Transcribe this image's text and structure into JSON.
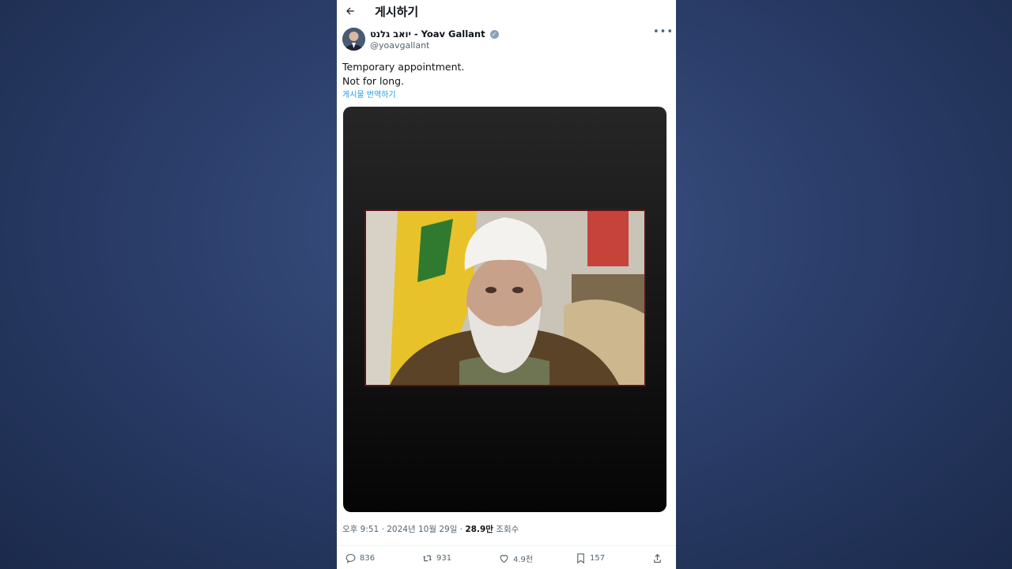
{
  "header": {
    "back_icon": "arrow-left-icon",
    "title": "게시하기"
  },
  "post": {
    "display_name": "יואב גלנט - Yoav Gallant",
    "verified_icon": "verified-badge-icon",
    "handle": "@yoavgallant",
    "more_icon": "more-horizontal-icon",
    "text_line1": "Temporary appointment.",
    "text_line2": "Not for long.",
    "translate_label": "게시물 번역하기",
    "meta_time": "오후 9:51 · 2024년 10월 29일 · ",
    "meta_views": "28.9만",
    "meta_views_label": " 조회수"
  },
  "actions": {
    "replies": "836",
    "reposts": "931",
    "likes": "4.9천",
    "bookmarks": "157"
  },
  "colors": {
    "link": "#1d9bf0",
    "muted": "#536471",
    "background": "#2c3f6c",
    "frame": "#5b1115"
  }
}
